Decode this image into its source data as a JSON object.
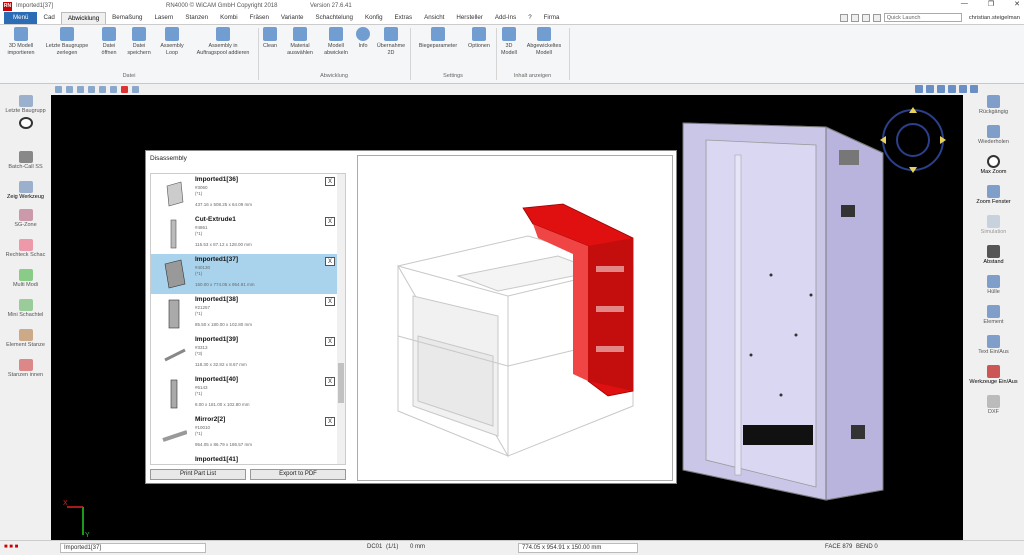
{
  "window": {
    "title": "Imported1[37]",
    "copyright": "RN4000 © WiCAM GmbH Copyright 2018",
    "version": "Version 27.6.41",
    "min": "—",
    "max": "❐",
    "close": "✕"
  },
  "menu": {
    "tabs": [
      "Menü",
      "Cad",
      "Abwicklung",
      "Bemaßung",
      "Lasern",
      "Stanzen",
      "Kombi",
      "Fräsen",
      "Variante",
      "Schachtelung",
      "Konfig",
      "Extras",
      "Ansicht",
      "Hersteller",
      "Add-Ins",
      "?",
      "Firma"
    ],
    "active": "Abwicklung",
    "search_placeholder": "Quick Launch",
    "user": "christian.steigelman"
  },
  "ribbon": {
    "buttons": [
      {
        "label1": "3D Modell",
        "label2": "importieren"
      },
      {
        "label1": "Letzte Baugruppe",
        "label2": "zerlegen"
      },
      {
        "label1": "Datei",
        "label2": "öffnen"
      },
      {
        "label1": "Datei",
        "label2": "speichern"
      },
      {
        "label1": "Assembly",
        "label2": "Loop"
      },
      {
        "label1": "Assembly in",
        "label2": "Auftragspool addieren"
      },
      {
        "label1": "Clean",
        "label2": ""
      },
      {
        "label1": "Material",
        "label2": "auswählen"
      },
      {
        "label1": "Modell",
        "label2": "abwickeln"
      },
      {
        "label1": "Info",
        "label2": ""
      },
      {
        "label1": "Übernahme",
        "label2": "2D"
      },
      {
        "label1": "Biegeparameter",
        "label2": ""
      },
      {
        "label1": "Optionen",
        "label2": ""
      },
      {
        "label1": "3D",
        "label2": "Modell"
      },
      {
        "label1": "Abgewickeltes",
        "label2": "Modell"
      }
    ],
    "groups": [
      "Datei",
      "Abwicklung",
      "Settings",
      "Inhalt anzeigen"
    ]
  },
  "left_panel": [
    "Letzte Baugrupp",
    "Batch-Call SS",
    "Zeig Werkzeug",
    "SG-Zone",
    "Rechteck Schac",
    "Multi Modi",
    "Mini Schachtel",
    "Element Stanze",
    "Stanzen innen"
  ],
  "right_panel": [
    "Rückgängig",
    "Wiederholen",
    "Max Zoom",
    "Zoom Fenster",
    "Simulation",
    "Abstand",
    "Hülle",
    "Element",
    "Text Ein/Aus",
    "Werkzeuge Ein/Aus",
    "DXF"
  ],
  "dialog": {
    "title": "Disassembly",
    "help": "?",
    "close": "✕",
    "items": [
      {
        "name": "Imported1[36]",
        "num": "#3060",
        "count": "(*1)",
        "dims": "437.16 x 508.25 x 64.09 mm",
        "selected": false
      },
      {
        "name": "Cut-Extrude1",
        "num": "#4861",
        "count": "(*1)",
        "dims": "115.53 x 87.12 x 128.00 mm",
        "selected": false
      },
      {
        "name": "Imported1[37]",
        "num": "#40130",
        "count": "(*1)",
        "dims": "150.00 x 774.05 x 954.91 mm",
        "selected": true
      },
      {
        "name": "Imported1[38]",
        "num": "#21257",
        "count": "(*1)",
        "dims": "85.50 x 180.00 x 102.80 mm",
        "selected": false
      },
      {
        "name": "Imported1[39]",
        "num": "#3313",
        "count": "(*3)",
        "dims": "118.30 x 32.82 x 8.67 mm",
        "selected": false
      },
      {
        "name": "Imported1[40]",
        "num": "#6143",
        "count": "(*1)",
        "dims": "8.00 x 181.00 x 102.80 mm",
        "selected": false
      },
      {
        "name": "Mirror2[2]",
        "num": "#10010",
        "count": "(*1)",
        "dims": "954.05 x 86.79 x 186.57 mm",
        "selected": false
      },
      {
        "name": "Imported1[41]",
        "num": "",
        "count": "",
        "dims": "",
        "selected": false
      }
    ],
    "x_label": "X",
    "print_button": "Print Part List",
    "export_button": "Export to PDF"
  },
  "status": {
    "part": "Imported1[37]",
    "dc": "DC01",
    "page": "(1/1)",
    "mm": "0 mm",
    "dims": "774.05 x 954.91 x 150.00 mm",
    "face": "FACE 879",
    "bend": "BEND 0"
  },
  "axes": {
    "x": "X",
    "y": "Y"
  },
  "colors": {
    "accent": "#2b6cb5",
    "highlight": "#e01010",
    "selection": "#a9d3ec",
    "model": "#c9c6e8"
  }
}
